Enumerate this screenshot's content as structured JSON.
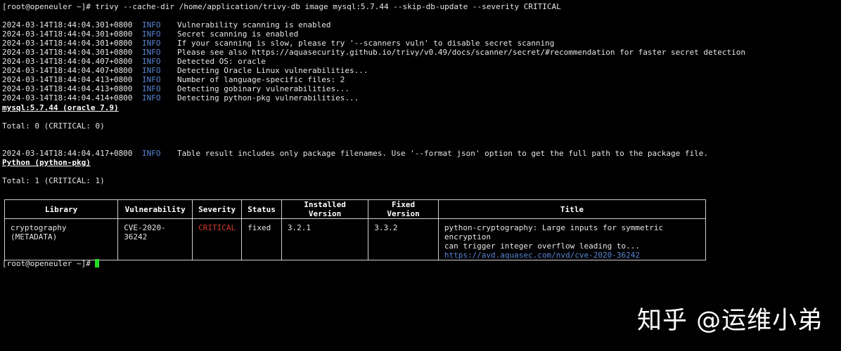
{
  "window": {
    "background": "#000000",
    "info_color": "#5a86d6",
    "critical_color": "#d23a2c",
    "cursor_color": "#22dd22"
  },
  "command_line": "[root@openeuler ~]# trivy --cache-dir /home/application/trivy-db image mysql:5.7.44 --skip-db-update --severity CRITICAL",
  "logs": [
    {
      "timestamp": "2024-03-14T18:44:04.301+0800",
      "level": "INFO",
      "message": "Vulnerability scanning is enabled"
    },
    {
      "timestamp": "2024-03-14T18:44:04.301+0800",
      "level": "INFO",
      "message": "Secret scanning is enabled"
    },
    {
      "timestamp": "2024-03-14T18:44:04.301+0800",
      "level": "INFO",
      "message": "If your scanning is slow, please try '--scanners vuln' to disable secret scanning"
    },
    {
      "timestamp": "2024-03-14T18:44:04.301+0800",
      "level": "INFO",
      "message": "Please see also https://aquasecurity.github.io/trivy/v0.49/docs/scanner/secret/#recommendation for faster secret detection"
    },
    {
      "timestamp": "2024-03-14T18:44:04.407+0800",
      "level": "INFO",
      "message": "Detected OS: oracle"
    },
    {
      "timestamp": "2024-03-14T18:44:04.407+0800",
      "level": "INFO",
      "message": "Detecting Oracle Linux vulnerabilities..."
    },
    {
      "timestamp": "2024-03-14T18:44:04.413+0800",
      "level": "INFO",
      "message": "Number of language-specific files: 2"
    },
    {
      "timestamp": "2024-03-14T18:44:04.413+0800",
      "level": "INFO",
      "message": "Detecting gobinary vulnerabilities..."
    },
    {
      "timestamp": "2024-03-14T18:44:04.414+0800",
      "level": "INFO",
      "message": "Detecting python-pkg vulnerabilities..."
    }
  ],
  "section1": {
    "heading": "mysql:5.7.44 (oracle 7.9)",
    "total": "Total: 0 (CRITICAL: 0)"
  },
  "table_log": {
    "timestamp": "2024-03-14T18:44:04.417+0800",
    "level": "INFO",
    "message": "Table result includes only package filenames. Use '--format json' option to get the full path to the package file."
  },
  "section2": {
    "heading": "Python (python-pkg)",
    "total": "Total: 1 (CRITICAL: 1)"
  },
  "table": {
    "headers": [
      "Library",
      "Vulnerability",
      "Severity",
      "Status",
      "Installed Version",
      "Fixed Version",
      "Title"
    ],
    "rows": [
      {
        "library": "cryptography (METADATA)",
        "vulnerability": "CVE-2020-36242",
        "severity": "CRITICAL",
        "status": "fixed",
        "installed_version": "3.2.1",
        "fixed_version": "3.3.2",
        "title_line1": "python-cryptography: Large inputs for symmetric encryption",
        "title_line2": "can trigger integer overflow leading to...",
        "title_url": "https://avd.aquasec.com/nvd/cve-2020-36242"
      }
    ]
  },
  "prompt": "[root@openeuler ~]# ",
  "watermark": "知乎 @运维小弟"
}
